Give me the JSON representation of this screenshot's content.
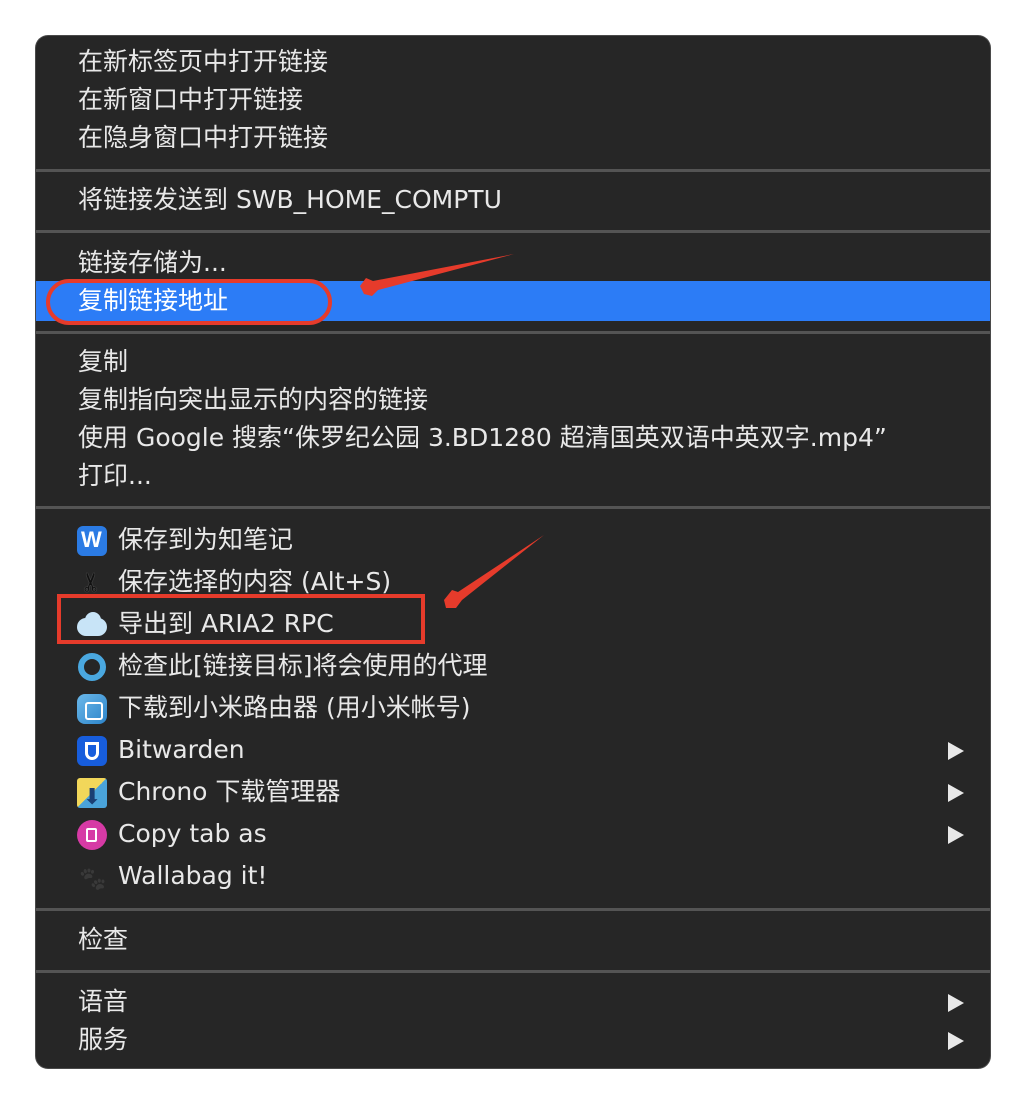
{
  "menu": {
    "group1": [
      {
        "label": "在新标签页中打开链接"
      },
      {
        "label": "在新窗口中打开链接"
      },
      {
        "label": "在隐身窗口中打开链接"
      }
    ],
    "group2": [
      {
        "label": "将链接发送到 SWB_HOME_COMPTU"
      }
    ],
    "group3": [
      {
        "label": "链接存储为..."
      },
      {
        "label": "复制链接地址"
      }
    ],
    "group4": [
      {
        "label": "复制"
      },
      {
        "label": "复制指向突出显示的内容的链接"
      },
      {
        "label": "使用 Google 搜索“侏罗纪公园 3.BD1280 超清国英双语中英双字.mp4”"
      },
      {
        "label": "打印..."
      }
    ],
    "extensions": [
      {
        "label": "保存到为知笔记",
        "icon": "wiznote-icon",
        "submenu": false
      },
      {
        "label": "保存选择的内容 (Alt+S)",
        "icon": "scissors-icon",
        "submenu": false
      },
      {
        "label": "导出到 ARIA2 RPC",
        "icon": "aria2-cloud-icon",
        "submenu": false
      },
      {
        "label": "检查此[链接目标]将会使用的代理",
        "icon": "proxy-ring-icon",
        "submenu": false
      },
      {
        "label": "下载到小米路由器 (用小米帐号)",
        "icon": "xiaomi-router-icon",
        "submenu": false
      },
      {
        "label": "Bitwarden",
        "icon": "bitwarden-shield-icon",
        "submenu": true
      },
      {
        "label": "Chrono 下载管理器",
        "icon": "chrono-download-icon",
        "submenu": true
      },
      {
        "label": "Copy tab as",
        "icon": "copy-tab-icon",
        "submenu": true
      },
      {
        "label": "Wallabag it!",
        "icon": "wallabag-icon",
        "submenu": false
      }
    ],
    "group6": [
      {
        "label": "检查"
      }
    ],
    "group7": [
      {
        "label": "语音",
        "submenu": true
      },
      {
        "label": "服务",
        "submenu": true
      }
    ]
  },
  "colors": {
    "menu_bg": "#262626",
    "highlight": "#2c7cf6",
    "annotation": "#e63b2b"
  }
}
